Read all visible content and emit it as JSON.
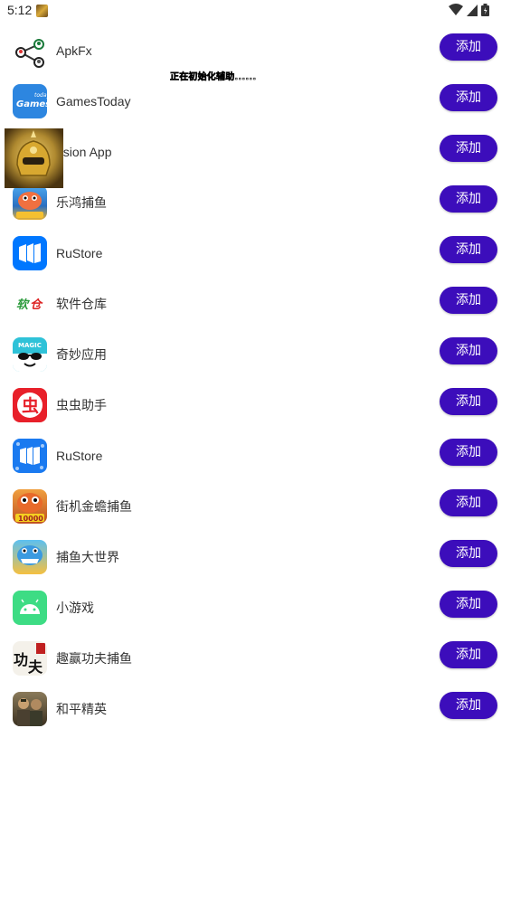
{
  "status_bar": {
    "time": "5:12",
    "icons": [
      "app-notification-icon",
      "wifi-icon",
      "cell-signal-icon",
      "battery-icon"
    ]
  },
  "overlay": {
    "text": "正在初始化辅助......"
  },
  "colors": {
    "button_bg": "#3c0dbb",
    "button_text": "#ffffff"
  },
  "apps": [
    {
      "name": "ApkFx",
      "icon": "share-nodes-icon",
      "button": "添加"
    },
    {
      "name": "GamesToday",
      "icon": "gamestoday-icon",
      "button": "添加"
    },
    {
      "name": "usion App",
      "icon": "floating-app-icon",
      "button": "添加"
    },
    {
      "name": "乐鸿捕鱼",
      "icon": "fish-game-icon",
      "button": "添加"
    },
    {
      "name": "RuStore",
      "icon": "rustore-icon",
      "button": "添加"
    },
    {
      "name": "软件仓库",
      "icon": "software-repo-icon",
      "button": "添加"
    },
    {
      "name": "奇妙应用",
      "icon": "magic-app-icon",
      "button": "添加"
    },
    {
      "name": "虫虫助手",
      "icon": "chongchong-icon",
      "button": "添加"
    },
    {
      "name": "RuStore",
      "icon": "rustore-icon",
      "button": "添加"
    },
    {
      "name": "街机金蟾捕鱼",
      "icon": "arcade-toad-icon",
      "button": "添加"
    },
    {
      "name": "捕鱼大世界",
      "icon": "shark-game-icon",
      "button": "添加"
    },
    {
      "name": "小游戏",
      "icon": "android-icon",
      "button": "添加"
    },
    {
      "name": "趣赢功夫捕鱼",
      "icon": "kungfu-fish-icon",
      "button": "添加"
    },
    {
      "name": "和平精英",
      "icon": "peacekeeper-elite-icon",
      "button": "添加"
    }
  ]
}
